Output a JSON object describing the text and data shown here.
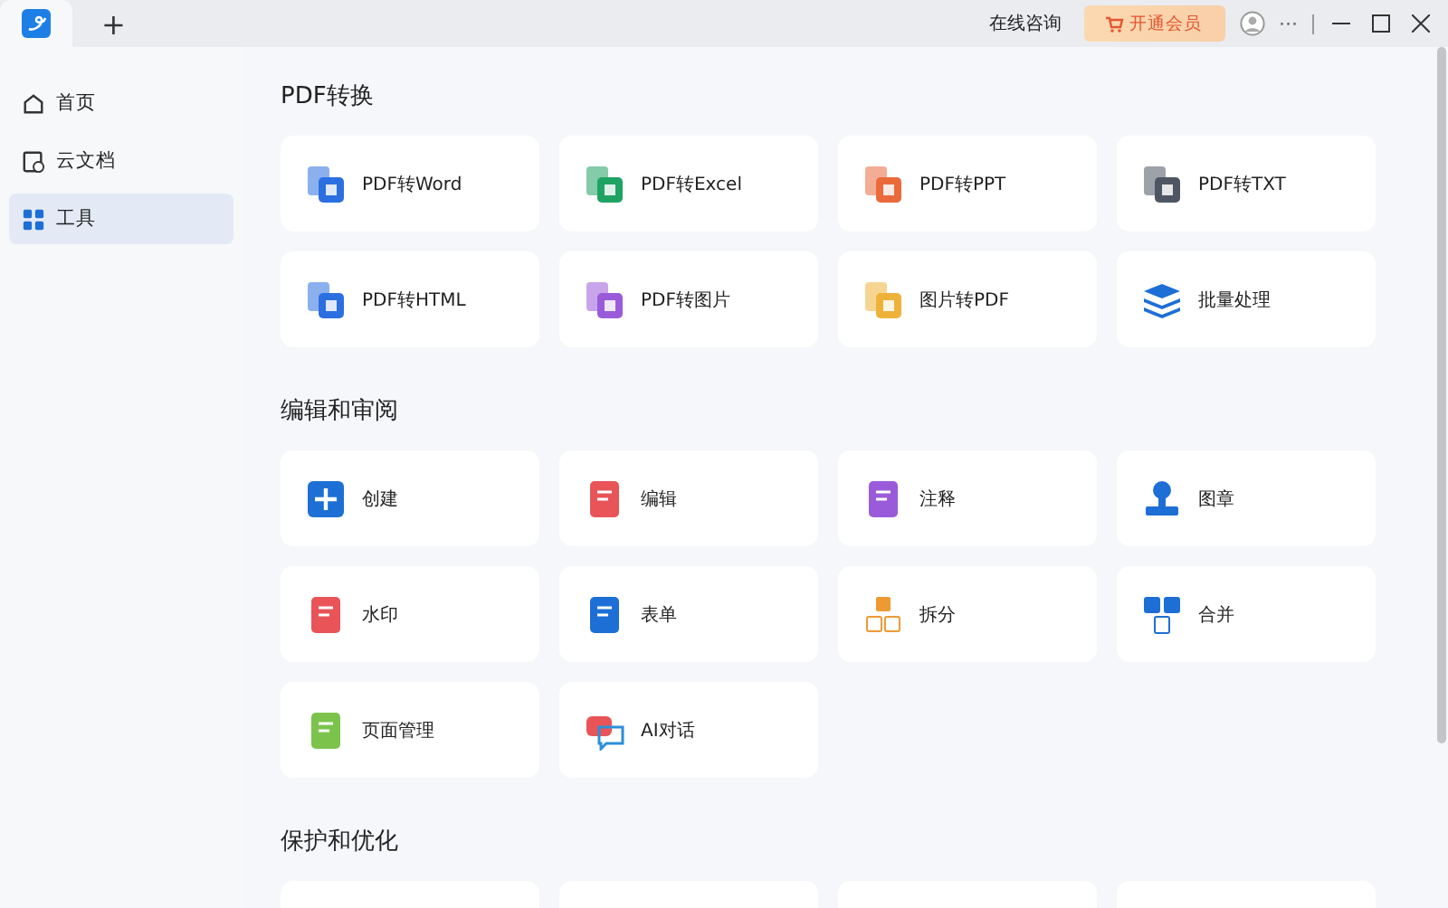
{
  "titlebar": {
    "new_tab": "+",
    "consult": "在线咨询",
    "vip_button": "开通会员",
    "more": "···"
  },
  "sidebar": {
    "items": [
      {
        "label": "首页",
        "selected": false
      },
      {
        "label": "云文档",
        "selected": false
      },
      {
        "label": "工具",
        "selected": true
      }
    ]
  },
  "sections": [
    {
      "title": "PDF转换",
      "tools": [
        {
          "label": "PDF转Word"
        },
        {
          "label": "PDF转Excel"
        },
        {
          "label": "PDF转PPT"
        },
        {
          "label": "PDF转TXT"
        },
        {
          "label": "PDF转HTML"
        },
        {
          "label": "PDF转图片"
        },
        {
          "label": "图片转PDF"
        },
        {
          "label": "批量处理"
        }
      ]
    },
    {
      "title": "编辑和审阅",
      "tools": [
        {
          "label": "创建"
        },
        {
          "label": "编辑"
        },
        {
          "label": "注释"
        },
        {
          "label": "图章"
        },
        {
          "label": "水印"
        },
        {
          "label": "表单"
        },
        {
          "label": "拆分"
        },
        {
          "label": "合并"
        },
        {
          "label": "页面管理"
        },
        {
          "label": "AI对话"
        }
      ]
    },
    {
      "title": "保护和优化"
    }
  ]
}
